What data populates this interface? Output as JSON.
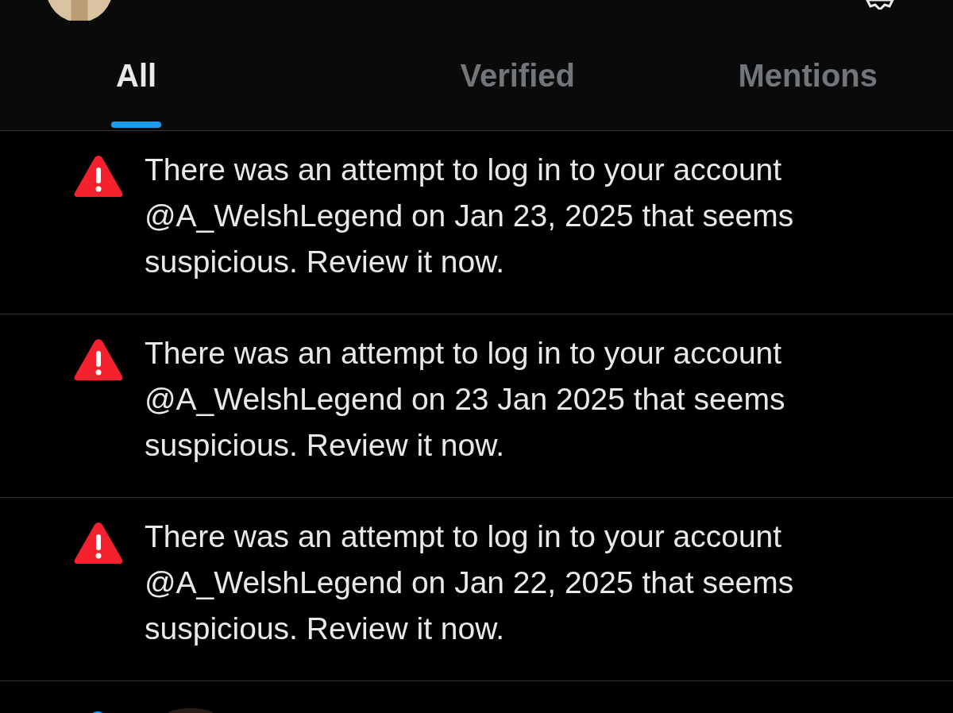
{
  "tabs": [
    {
      "label": "All",
      "selected": true
    },
    {
      "label": "Verified",
      "selected": false
    },
    {
      "label": "Mentions",
      "selected": false
    }
  ],
  "notifications": [
    {
      "kind": "warning",
      "text": "There was an attempt to log in to your account @A_WelshLegend on Jan 23, 2025 that seems suspicious. Review it now."
    },
    {
      "kind": "warning",
      "text": "There was an attempt to log in to your account @A_WelshLegend on 23 Jan 2025 that seems suspicious. Review it now."
    },
    {
      "kind": "warning",
      "text": "There was an attempt to log in to your account @A_WelshLegend on Jan 22, 2025 that seems suspicious. Review it now."
    }
  ]
}
